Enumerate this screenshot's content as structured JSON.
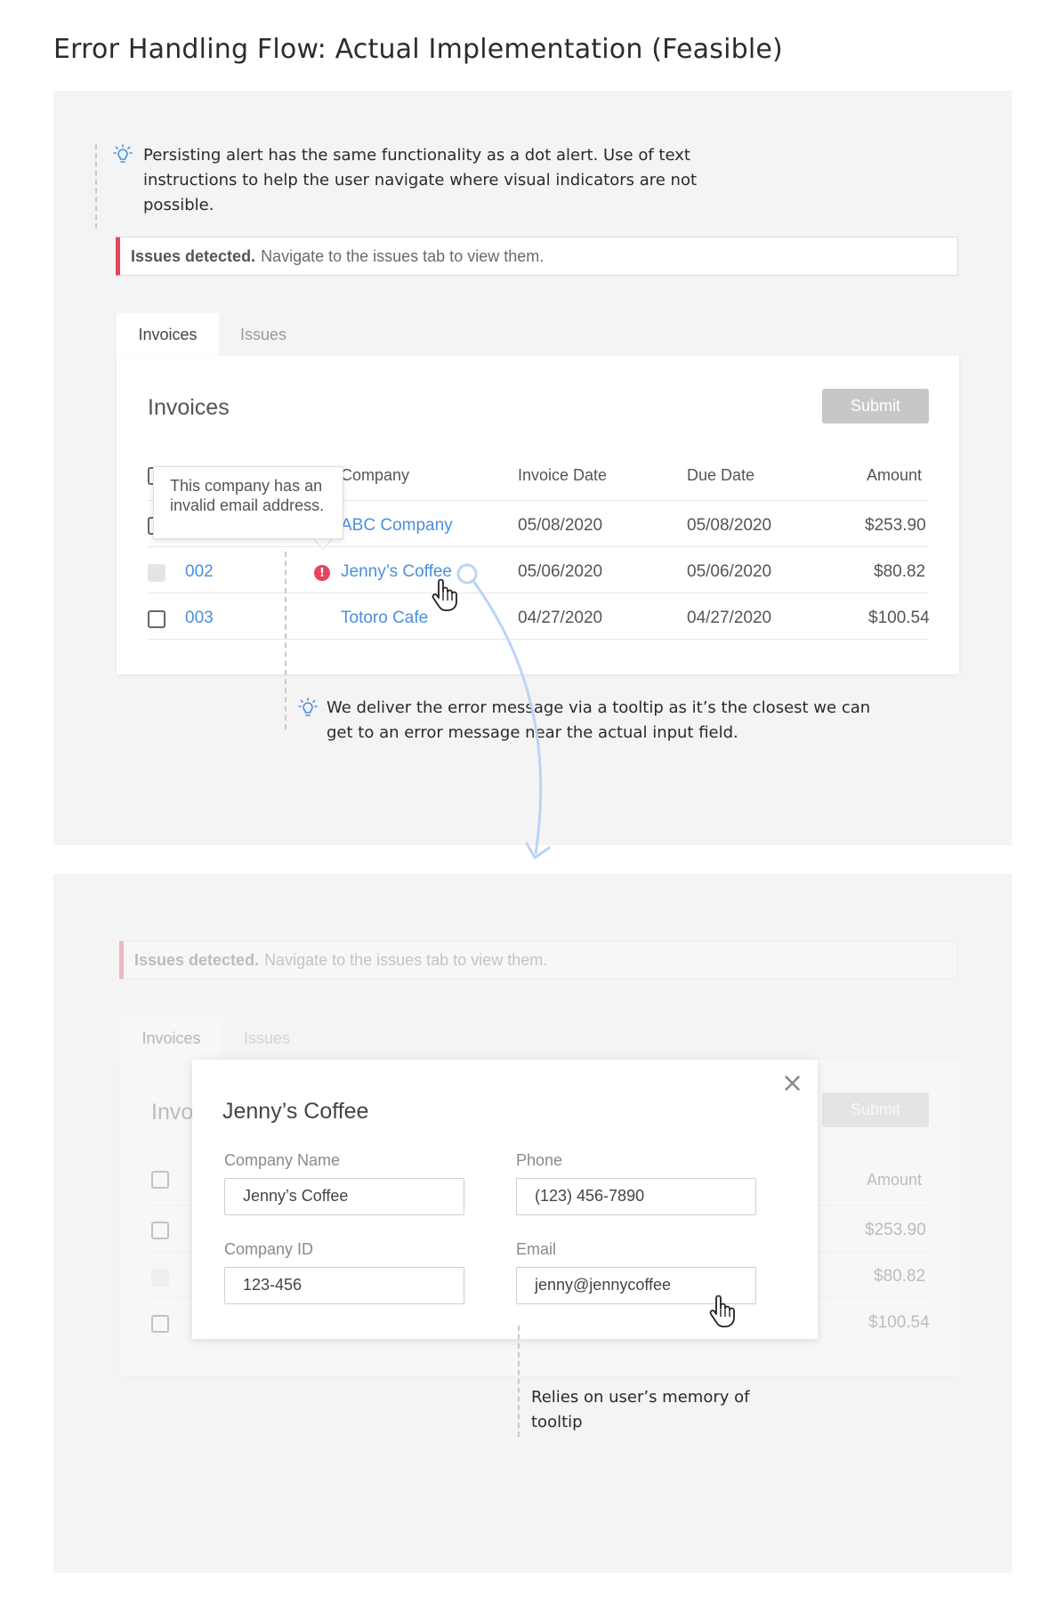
{
  "page_title": "Error Handling Flow: Actual Implementation (Feasible)",
  "top": {
    "note1": "Persisting alert has the same functionality as a dot alert. Use of text instructions to help the user navigate where visual indicators are not possible.",
    "alert": {
      "bold": "Issues detected.",
      "text": "Navigate to the issues tab to view them."
    },
    "tabs": [
      {
        "label": "Invoices"
      },
      {
        "label": "Issues"
      }
    ],
    "card_title": "Invoices",
    "submit_label": "Submit",
    "columns": {
      "company": "Company",
      "invoice_date": "Invoice Date",
      "due_date": "Due Date",
      "amount": "Amount"
    },
    "rows": [
      {
        "id": "",
        "company": "ABC Company",
        "invoice_date": "05/08/2020",
        "due_date": "05/08/2020",
        "amount": "$253.90"
      },
      {
        "id": "002",
        "company": "Jenny’s Coffee",
        "invoice_date": "05/06/2020",
        "due_date": "05/06/2020",
        "amount": "$80.82"
      },
      {
        "id": "003",
        "company": "Totoro Cafe",
        "invoice_date": "04/27/2020",
        "due_date": "04/27/2020",
        "amount": "$100.54"
      }
    ],
    "tooltip": "This company has an invalid email address.",
    "error_icon": "!",
    "note2": "We deliver the error message via a tooltip as it’s the closest we can get to an error message near the actual input field."
  },
  "bottom": {
    "alert": {
      "bold": "Issues detected.",
      "text": "Navigate to the issues tab to view them."
    },
    "tabs": [
      {
        "label": "Invoices"
      },
      {
        "label": "Issues"
      }
    ],
    "card_title_partial": "Invo",
    "submit_label": "Submit",
    "amount_header": "Amount",
    "amounts": [
      "$253.90",
      "$80.82",
      "$100.54"
    ],
    "modal": {
      "title": "Jenny’s Coffee",
      "close": "×",
      "fields": {
        "company_name": {
          "label": "Company Name",
          "value": "Jenny’s Coffee"
        },
        "phone": {
          "label": "Phone",
          "value": "(123) 456-7890"
        },
        "company_id": {
          "label": "Company ID",
          "value": "123-456"
        },
        "email": {
          "label": "Email",
          "value": "jenny@jennycoffee"
        }
      }
    },
    "note": "Relies on user’s memory of tooltip"
  },
  "colors": {
    "accent_red": "#e5455a",
    "link_blue": "#4a8fdc",
    "bulb_blue": "#4a8fdc",
    "arrow_blue": "#bcd4f3"
  },
  "icons": [
    "lightbulb-icon",
    "error-icon",
    "pointer-hand-icon",
    "close-icon",
    "checkbox-icon"
  ]
}
